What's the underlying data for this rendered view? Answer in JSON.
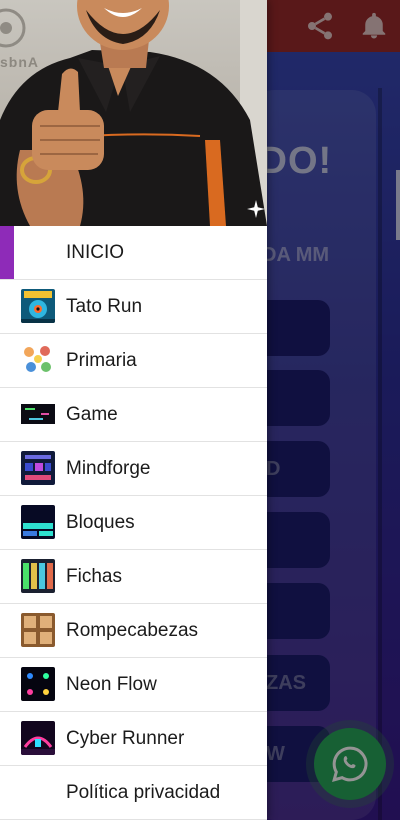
{
  "background": {
    "card_title": "IDO!",
    "card_subtitle": "DA MM",
    "buttons": [
      "",
      "",
      "D",
      "",
      "",
      "ZAS",
      "W"
    ]
  },
  "header_art": {
    "wall_text": "sbnA"
  },
  "menu": {
    "items": [
      {
        "label": "INICIO",
        "icon": "home",
        "active": true
      },
      {
        "label": "Tato Run",
        "icon": "tato-run-thumbnail"
      },
      {
        "label": "Primaria",
        "icon": "primaria-thumbnail"
      },
      {
        "label": "Game",
        "icon": "game-thumbnail"
      },
      {
        "label": "Mindforge",
        "icon": "mindforge-thumbnail"
      },
      {
        "label": "Bloques",
        "icon": "bloques-thumbnail"
      },
      {
        "label": "Fichas",
        "icon": "fichas-thumbnail"
      },
      {
        "label": "Rompecabezas",
        "icon": "rompecabezas-thumbnail"
      },
      {
        "label": "Neon Flow",
        "icon": "neon-flow-thumbnail"
      },
      {
        "label": "Cyber Runner",
        "icon": "cyber-runner-thumbnail"
      },
      {
        "label": "Política privacidad",
        "icon": "none"
      }
    ]
  },
  "colors": {
    "active_indicator": "#8e2bb8",
    "header_bar": "#9a2a2c",
    "whatsapp": "#28a55a"
  }
}
